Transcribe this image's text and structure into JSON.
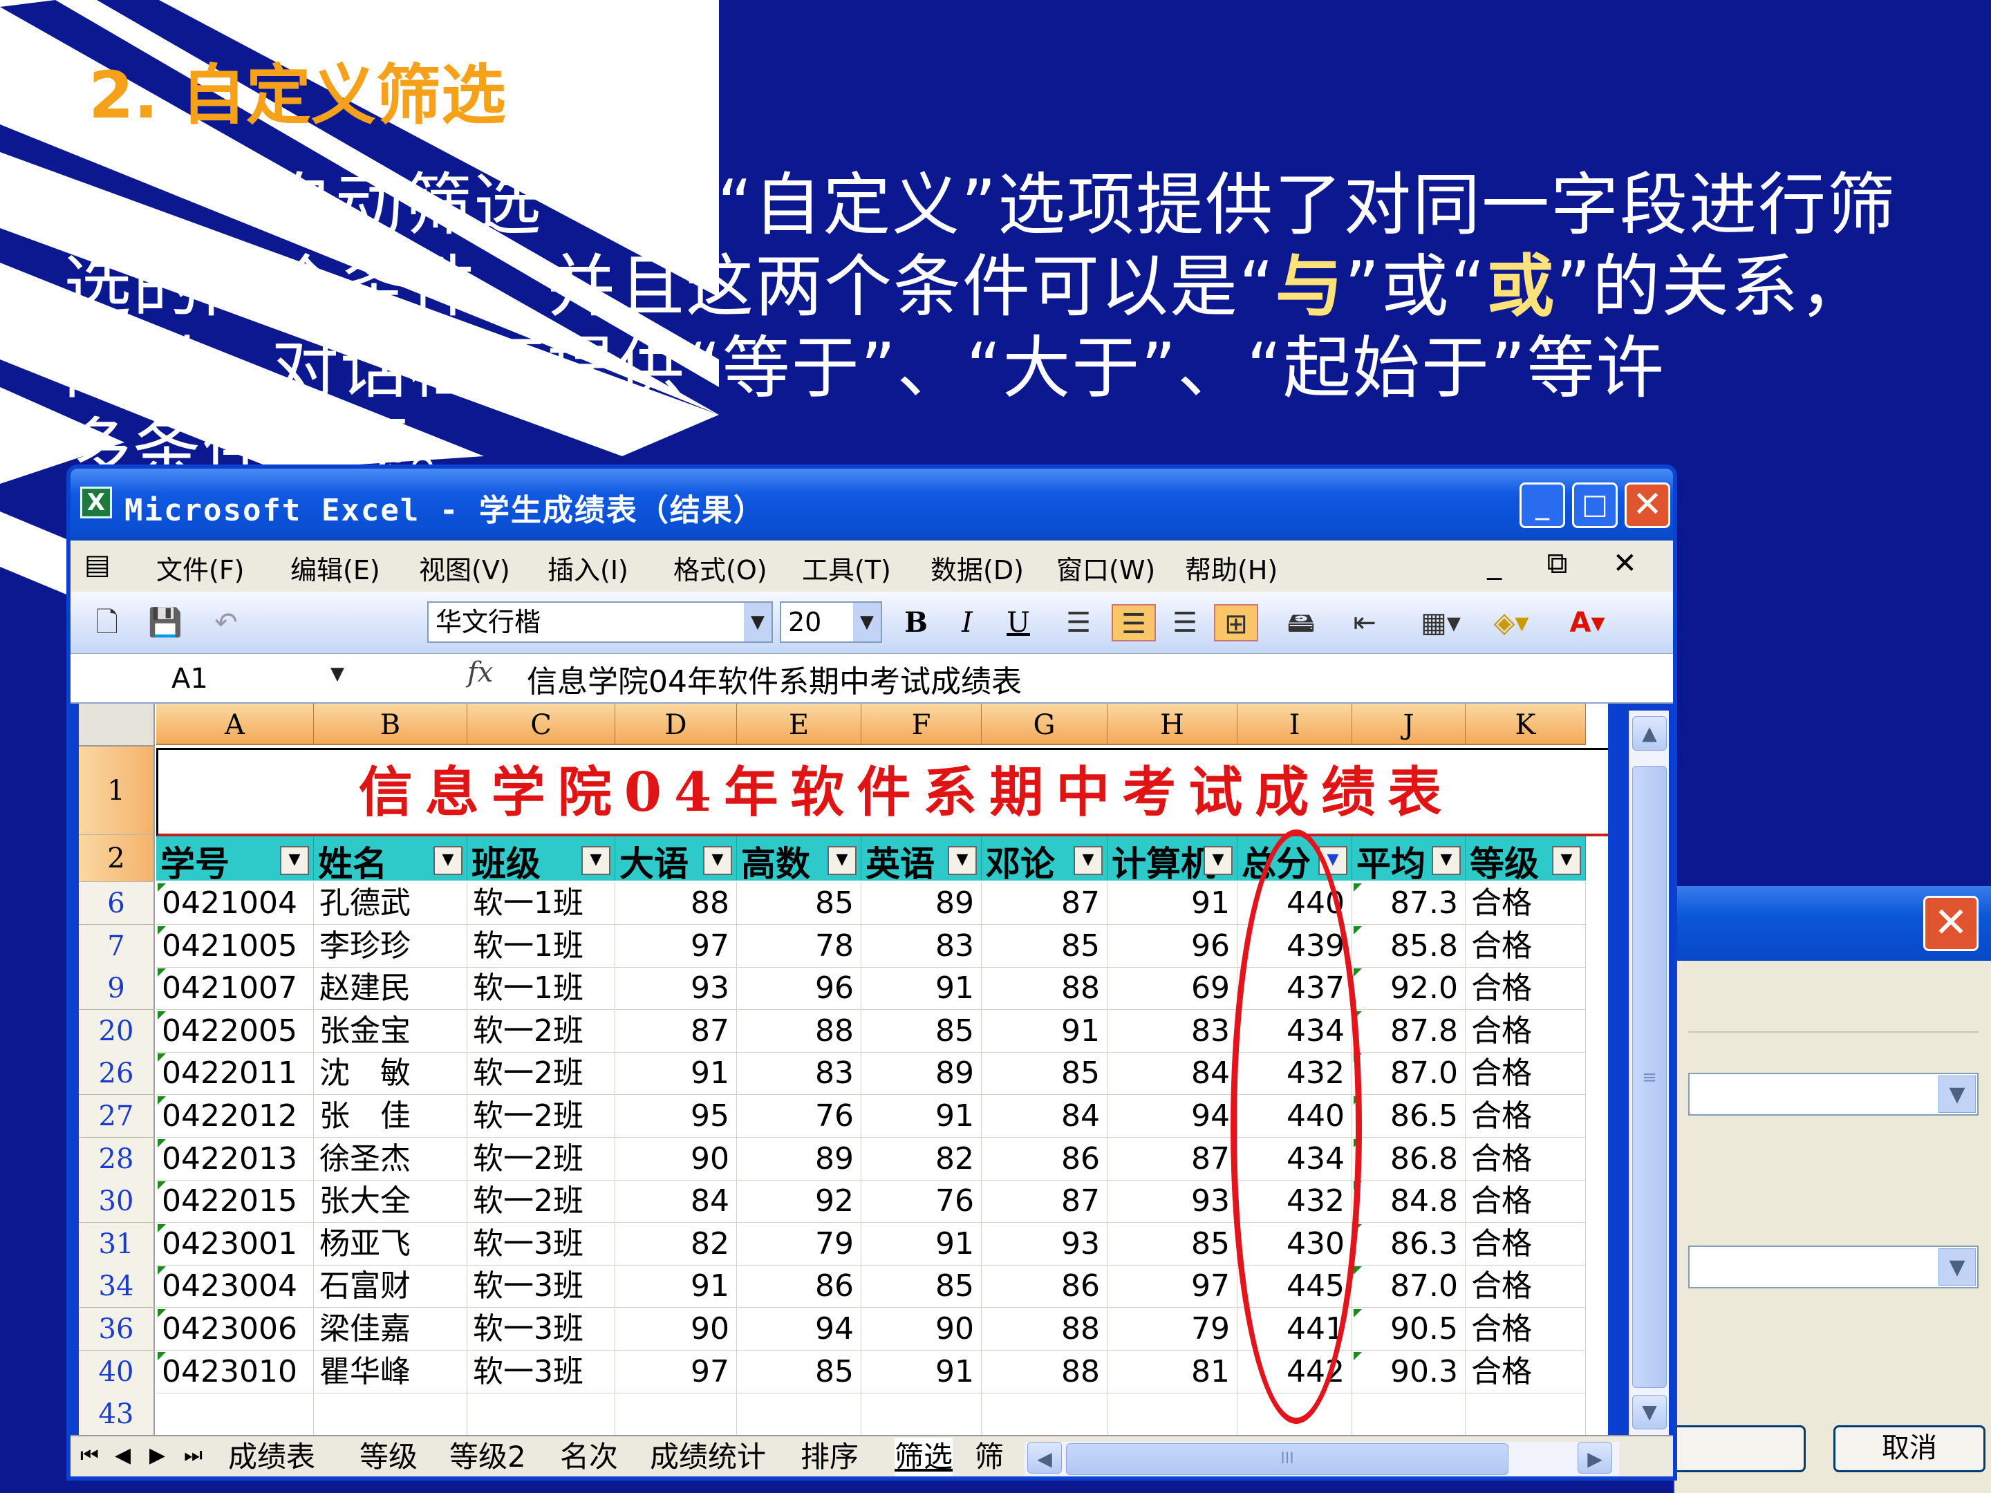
{
  "slide": {
    "title": "2. 自定义筛选",
    "body_line1_a": "“自动筛选”中的“自定义”选项提供了对同一字段进行筛",
    "body_line2_a": "选的两个条件，并且这两个条件可以是“",
    "body_em1": "与",
    "body_line2_b": "”或“",
    "body_em2": "或",
    "body_line2_c": "”的关系，",
    "body_line3": "同时，对话框还提供“等于”、“大于”、“起始于”等许",
    "body_line4": "多条件选项。",
    "colors": {
      "background": "#0b1890",
      "title": "#f5a21a",
      "emphasis": "#ffe27a",
      "annotation": "#e3141b"
    }
  },
  "dialog": {
    "close_icon": "close-icon",
    "cancel_label": "取消"
  },
  "excel": {
    "window_title": "Microsoft Excel - 学生成绩表（结果）",
    "window_buttons": {
      "minimize": "_",
      "maximize": "□",
      "close": "✕"
    },
    "menu": [
      "文件(F)",
      "编辑(E)",
      "视图(V)",
      "插入(I)",
      "格式(O)",
      "工具(T)",
      "数据(D)",
      "窗口(W)",
      "帮助(H)"
    ],
    "menu_right": "_ ⧉ ✕",
    "toolbar": {
      "font": "华文行楷",
      "font_size": "20",
      "bold": "B",
      "italic": "I",
      "underline": "U",
      "font_color_label": "A"
    },
    "name_box": "A1",
    "fx_label": "fx",
    "formula": "信息学院04年软件系期中考试成绩表",
    "columns": [
      "A",
      "B",
      "C",
      "D",
      "E",
      "F",
      "G",
      "H",
      "I",
      "J",
      "K"
    ],
    "sheet_title": "信息学院04年软件系期中考试成绩表",
    "headers": [
      "学号",
      "姓名",
      "班级",
      "大语",
      "高数",
      "英语",
      "邓论",
      "计算机",
      "总分",
      "平均",
      "等级"
    ],
    "rows": [
      {
        "row": "6",
        "cells": [
          "0421004",
          "孔德武",
          "软一1班",
          "88",
          "85",
          "89",
          "87",
          "91",
          "440",
          "87.3",
          "合格"
        ]
      },
      {
        "row": "7",
        "cells": [
          "0421005",
          "李珍珍",
          "软一1班",
          "97",
          "78",
          "83",
          "85",
          "96",
          "439",
          "85.8",
          "合格"
        ]
      },
      {
        "row": "9",
        "cells": [
          "0421007",
          "赵建民",
          "软一1班",
          "93",
          "96",
          "91",
          "88",
          "69",
          "437",
          "92.0",
          "合格"
        ]
      },
      {
        "row": "20",
        "cells": [
          "0422005",
          "张金宝",
          "软一2班",
          "87",
          "88",
          "85",
          "91",
          "83",
          "434",
          "87.8",
          "合格"
        ]
      },
      {
        "row": "26",
        "cells": [
          "0422011",
          "沈　敏",
          "软一2班",
          "91",
          "83",
          "89",
          "85",
          "84",
          "432",
          "87.0",
          "合格"
        ]
      },
      {
        "row": "27",
        "cells": [
          "0422012",
          "张　佳",
          "软一2班",
          "95",
          "76",
          "91",
          "84",
          "94",
          "440",
          "86.5",
          "合格"
        ]
      },
      {
        "row": "28",
        "cells": [
          "0422013",
          "徐圣杰",
          "软一2班",
          "90",
          "89",
          "82",
          "86",
          "87",
          "434",
          "86.8",
          "合格"
        ]
      },
      {
        "row": "30",
        "cells": [
          "0422015",
          "张大全",
          "软一2班",
          "84",
          "92",
          "76",
          "87",
          "93",
          "432",
          "84.8",
          "合格"
        ]
      },
      {
        "row": "31",
        "cells": [
          "0423001",
          "杨亚飞",
          "软一3班",
          "82",
          "79",
          "91",
          "93",
          "85",
          "430",
          "86.3",
          "合格"
        ]
      },
      {
        "row": "34",
        "cells": [
          "0423004",
          "石富财",
          "软一3班",
          "91",
          "86",
          "85",
          "86",
          "97",
          "445",
          "87.0",
          "合格"
        ]
      },
      {
        "row": "36",
        "cells": [
          "0423006",
          "梁佳嘉",
          "软一3班",
          "90",
          "94",
          "90",
          "88",
          "79",
          "441",
          "90.5",
          "合格"
        ]
      },
      {
        "row": "40",
        "cells": [
          "0423010",
          "瞿华峰",
          "软一3班",
          "97",
          "85",
          "91",
          "88",
          "81",
          "442",
          "90.3",
          "合格"
        ]
      }
    ],
    "empty_row": "43",
    "title_row": "1",
    "header_row": "2",
    "sheet_tabs": [
      "成绩表",
      "等级",
      "等级2",
      "名次",
      "成绩统计",
      "排序",
      "筛选",
      "筛"
    ],
    "active_tab": "筛选",
    "tab_nav": [
      "⏮",
      "◀",
      "▶",
      "⏭"
    ]
  }
}
